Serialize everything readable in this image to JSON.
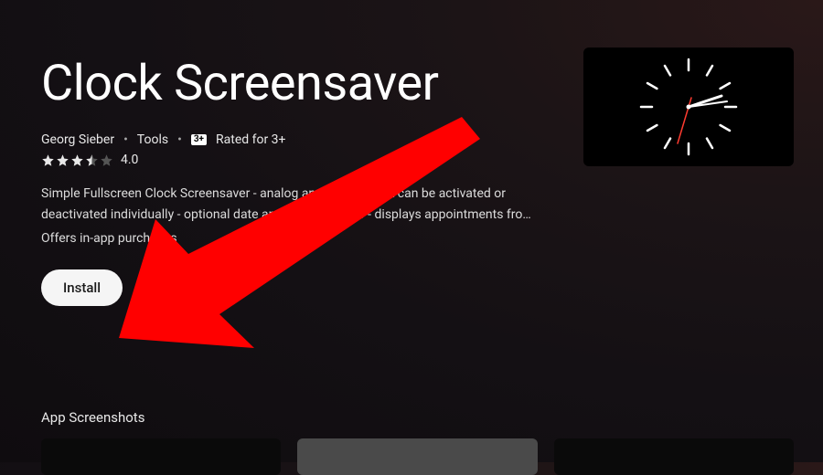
{
  "app": {
    "title": "Clock Screensaver",
    "developer": "Georg Sieber",
    "category": "Tools",
    "content_rating_badge": "3+",
    "content_rating_label": "Rated for 3+",
    "rating_value": "4.0",
    "star_rating": 3.5,
    "description": "Simple Fullscreen Clock Screensaver - analog and digital clock can be activated or deactivated individually - optional date and weekday view - displays appointments fro…",
    "iap_notice": "Offers in-app purchases",
    "install_label": "Install"
  },
  "sections": {
    "screenshots_title": "App Screenshots"
  },
  "annotation": {
    "arrow_color": "#ff0000"
  }
}
